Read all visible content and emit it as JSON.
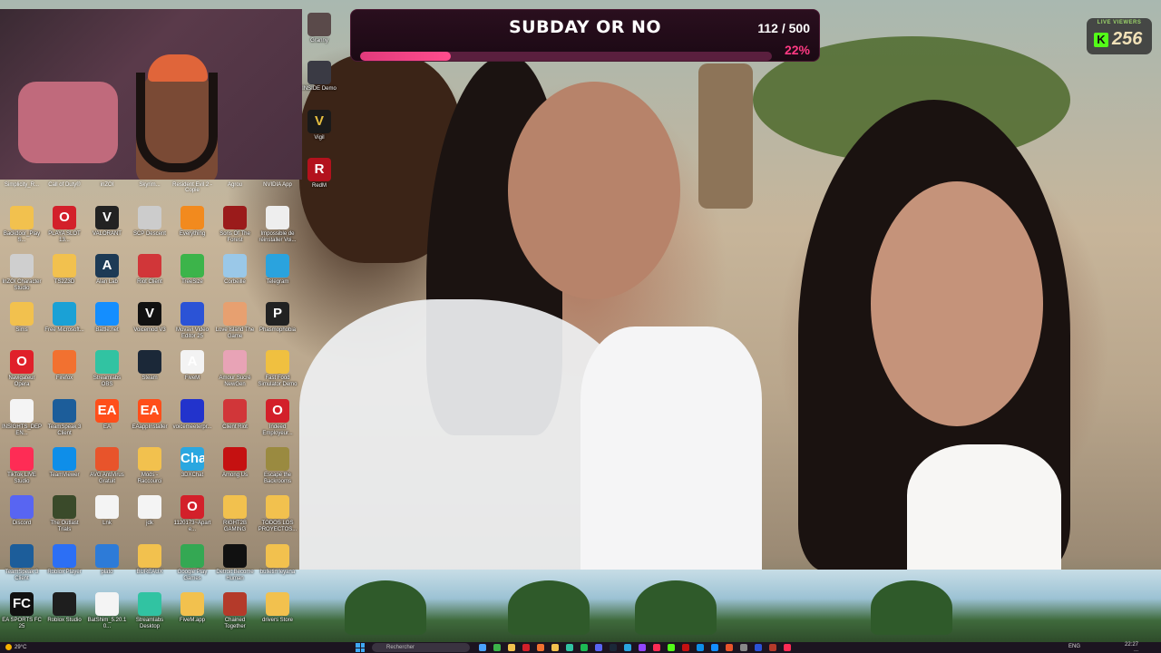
{
  "overlay": {
    "poll_title": "SUBDAY OR NO",
    "poll_count": "112 / 500",
    "poll_percent": "22%",
    "poll_progress": 0.22,
    "viewers_label": "LIVE VIEWERS",
    "viewers_count": "256",
    "viewers_logo": "K"
  },
  "top_captions": [
    "Simplicity_R...",
    "Call of Duty®",
    "inZOI",
    "Skyrim...",
    "Resident Evil 2 - Copie",
    "Agrou",
    "NVIDIA App"
  ],
  "right_column": [
    {
      "label": "Granny",
      "icon": "granny-icon",
      "color": "#5a4a4a"
    },
    {
      "label": "INSIDE Demo",
      "icon": "inside-icon",
      "color": "#3a3a44"
    },
    {
      "label": "Vigil",
      "icon": "vigil-icon",
      "color": "#1a1a1a",
      "glyph": "V"
    },
    {
      "label": "RedM",
      "icon": "redm-icon",
      "color": "#b3121d",
      "glyph": "R"
    }
  ],
  "icons": [
    {
      "label": "Backdoor_PlayS...",
      "icon": "folder-icon",
      "color": "#f2c14e"
    },
    {
      "label": "PLAYA SLOT 13...",
      "icon": "opera-icon",
      "color": "#d3202a",
      "glyph": "O"
    },
    {
      "label": "VALORANT",
      "icon": "valorant-icon",
      "color": "#222",
      "glyph": "V"
    },
    {
      "label": "SCP Descent",
      "icon": "scp-icon",
      "color": "#ccc"
    },
    {
      "label": "Everything",
      "icon": "everything-icon",
      "color": "#f28a1e"
    },
    {
      "label": "Sons Of The Forest",
      "icon": "sons-forest-icon",
      "color": "#9b1b1b"
    },
    {
      "label": "Impossible de réinstaller Voi...",
      "icon": "document-icon",
      "color": "#eeeeee"
    },
    {
      "label": "InZOI Character Studio",
      "icon": "inzoi-studio-icon",
      "color": "#cfcfcf"
    },
    {
      "label": "TS2Z3D",
      "icon": "folder-icon",
      "color": "#f2c14e"
    },
    {
      "label": "Alan Lab",
      "icon": "alan-icon",
      "color": "#1d3a55",
      "glyph": "A"
    },
    {
      "label": "Riot Client",
      "icon": "riot-icon",
      "color": "#d13639"
    },
    {
      "label": "TreeSize",
      "icon": "treesize-icon",
      "color": "#3cb44a"
    },
    {
      "label": "Corbeille",
      "icon": "recycle-bin-icon",
      "color": "#9ac8e8"
    },
    {
      "label": "Telegram",
      "icon": "telegram-icon",
      "color": "#2aa3de"
    },
    {
      "label": "Sims",
      "icon": "folder-icon",
      "color": "#f2c14e"
    },
    {
      "label": "Free Microsoft...",
      "icon": "edge-icon",
      "color": "#1aa1d6"
    },
    {
      "label": "Battle.net",
      "icon": "battlenet-icon",
      "color": "#148eff"
    },
    {
      "label": "Voicemod V3",
      "icon": "voicemod-icon",
      "color": "#111",
      "glyph": "V"
    },
    {
      "label": "Movavi Video Editor 25",
      "icon": "movavi-icon",
      "color": "#2b53d6"
    },
    {
      "label": "Love Island The Game",
      "icon": "love-island-icon",
      "color": "#e7a070"
    },
    {
      "label": "Phasmophobia",
      "icon": "phasmophobia-icon",
      "color": "#222",
      "glyph": "P"
    },
    {
      "label": "Navigateur Opera",
      "icon": "opera-gx-icon",
      "color": "#e0202a",
      "glyph": "O"
    },
    {
      "label": "Firefox",
      "icon": "firefox-icon",
      "color": "#f27130"
    },
    {
      "label": "Streamlabs OBS",
      "icon": "streamlabs-icon",
      "color": "#31c3a2"
    },
    {
      "label": "Steam",
      "icon": "steam-icon",
      "color": "#1b2838"
    },
    {
      "label": "FiveM",
      "icon": "fivem-icon",
      "color": "#f3f3f3",
      "glyph": "A"
    },
    {
      "label": "Amour Sucré NewGen",
      "icon": "amour-sucre-icon",
      "color": "#e8a3b6"
    },
    {
      "label": "Fast Food Simulator Demo",
      "icon": "fast-food-icon",
      "color": "#f0c040"
    },
    {
      "label": "INSIGHTS_DEPEN...",
      "icon": "document-icon",
      "color": "#f4f4f4"
    },
    {
      "label": "TeamSpeak 3 Client",
      "icon": "teamspeak-icon",
      "color": "#1c5d9a"
    },
    {
      "label": "EA",
      "icon": "ea-icon",
      "color": "#ff4e1a",
      "glyph": "EA"
    },
    {
      "label": "EAappInstaller",
      "icon": "ea-installer-icon",
      "color": "#ff4e1a",
      "glyph": "EA"
    },
    {
      "label": "voicemeeterpr...",
      "icon": "voicemeeter-icon",
      "color": "#2233cc"
    },
    {
      "label": "Client Riot",
      "icon": "riot-client-icon",
      "color": "#d13639"
    },
    {
      "label": "Indeed Employeur...",
      "icon": "opera-icon",
      "color": "#d3202a",
      "glyph": "O"
    },
    {
      "label": "TikTok LIVE Studio",
      "icon": "tiktok-icon",
      "color": "#fe2c55"
    },
    {
      "label": "TeamViewer",
      "icon": "teamviewer-icon",
      "color": "#0e8ee9"
    },
    {
      "label": "AVG AntiVirus Gratuit",
      "icon": "avg-icon",
      "color": "#e8542b"
    },
    {
      "label": "Mods - Raccourci",
      "icon": "folder-icon",
      "color": "#f2c14e"
    },
    {
      "label": "3DXChat",
      "icon": "3dxchat-icon",
      "color": "#2aa7e0",
      "glyph": "Chat"
    },
    {
      "label": "Among Us",
      "icon": "among-us-icon",
      "color": "#c51111"
    },
    {
      "label": "Escape the Backrooms",
      "icon": "backrooms-icon",
      "color": "#9a8a40"
    },
    {
      "label": "Discord",
      "icon": "discord-icon",
      "color": "#5865f2"
    },
    {
      "label": "The Outlast Trials",
      "icon": "outlast-icon",
      "color": "#3a4a2a"
    },
    {
      "label": "Lnk",
      "icon": "document-icon",
      "color": "#f4f4f4"
    },
    {
      "label": "jdk",
      "icon": "document-icon",
      "color": "#f4f4f4"
    },
    {
      "label": "1120173~Aparte...",
      "icon": "opera-icon",
      "color": "#d3202a",
      "glyph": "O"
    },
    {
      "label": "RIGHT2B GAMING",
      "icon": "folder-icon",
      "color": "#f2c14e"
    },
    {
      "label": "TODOS LOS PROYECTOS...",
      "icon": "folder-icon",
      "color": "#f2c14e"
    },
    {
      "label": "TeamSpeak 3 Client",
      "icon": "teamspeak-icon",
      "color": "#1c5d9a"
    },
    {
      "label": "Roblox Player",
      "icon": "roblox-icon",
      "color": "#2c6ff5"
    },
    {
      "label": "plato",
      "icon": "plato-icon",
      "color": "#2d7bd8"
    },
    {
      "label": "BUREAUX",
      "icon": "folder-icon",
      "color": "#f2c14e"
    },
    {
      "label": "Google Play Games",
      "icon": "google-play-games-icon",
      "color": "#34a853"
    },
    {
      "label": "Detroit Become Human",
      "icon": "detroit-icon",
      "color": "#111"
    },
    {
      "label": "bulletin leyana",
      "icon": "folder-icon",
      "color": "#f2c14e"
    },
    {
      "label": "EA SPORTS FC 25",
      "icon": "ea-fc-icon",
      "color": "#111",
      "glyph": "FC"
    },
    {
      "label": "Roblox Studio",
      "icon": "roblox-studio-icon",
      "color": "#1e1e1e"
    },
    {
      "label": "BatShim_5.20.10...",
      "icon": "document-icon",
      "color": "#f4f4f4"
    },
    {
      "label": "Streamlabs Desktop",
      "icon": "streamlabs-desktop-icon",
      "color": "#31c3a2"
    },
    {
      "label": "FiveM.app",
      "icon": "folder-icon",
      "color": "#f2c14e"
    },
    {
      "label": "Chained Together",
      "icon": "chained-together-icon",
      "color": "#b43a2a"
    },
    {
      "label": "drivers Store",
      "icon": "folder-icon",
      "color": "#f2c14e"
    }
  ],
  "taskbar": {
    "weather": "29°C",
    "search_placeholder": "Rechercher",
    "lang": "ENG",
    "time": "22:27",
    "date": "..."
  }
}
